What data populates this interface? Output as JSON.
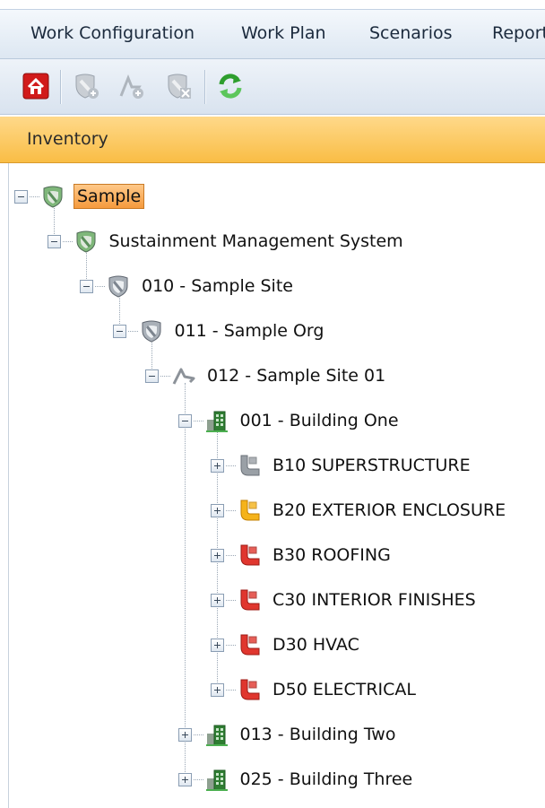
{
  "menu": {
    "items": [
      {
        "name": "menu-work-configuration",
        "label": "Work Configuration"
      },
      {
        "name": "menu-work-plan",
        "label": "Work Plan"
      },
      {
        "name": "menu-scenarios",
        "label": "Scenarios"
      },
      {
        "name": "menu-reports",
        "label": "Report"
      }
    ]
  },
  "toolbar": {
    "buttons": [
      {
        "name": "home-icon",
        "enabled": true
      },
      {
        "name": "add-shield-icon",
        "enabled": false
      },
      {
        "name": "add-site-icon",
        "enabled": false
      },
      {
        "name": "delete-shield-icon",
        "enabled": false
      },
      {
        "name": "refresh-icon",
        "enabled": true
      }
    ]
  },
  "panel": {
    "title": "Inventory"
  },
  "tree": {
    "nodes": [
      {
        "label": "Sample",
        "icon": "shield-icon",
        "level": 0,
        "expanded": true,
        "selected": true
      },
      {
        "label": "Sustainment Management System",
        "icon": "shield-icon",
        "level": 1,
        "expanded": true
      },
      {
        "label": "010 - Sample Site",
        "icon": "shield-gray-icon",
        "level": 2,
        "expanded": true
      },
      {
        "label": "011 - Sample Org",
        "icon": "shield-gray-icon",
        "level": 3,
        "expanded": true
      },
      {
        "label": "012 - Sample Site 01",
        "icon": "site-flag-icon",
        "level": 4,
        "expanded": true
      },
      {
        "label": "001 - Building One",
        "icon": "building-icon",
        "level": 5,
        "expanded": true
      },
      {
        "label": "B10 SUPERSTRUCTURE",
        "icon": "pipe-gray-icon",
        "level": 6,
        "expanded": false
      },
      {
        "label": "B20 EXTERIOR ENCLOSURE",
        "icon": "pipe-yellow-icon",
        "level": 6,
        "expanded": false
      },
      {
        "label": "B30 ROOFING",
        "icon": "pipe-red-icon",
        "level": 6,
        "expanded": false
      },
      {
        "label": "C30 INTERIOR FINISHES",
        "icon": "pipe-red-icon",
        "level": 6,
        "expanded": false
      },
      {
        "label": "D30 HVAC",
        "icon": "pipe-red-icon",
        "level": 6,
        "expanded": false
      },
      {
        "label": "D50 ELECTRICAL",
        "icon": "pipe-red-icon",
        "level": 6,
        "expanded": false
      },
      {
        "label": "013 - Building Two",
        "icon": "building-icon",
        "level": 5,
        "expanded": false
      },
      {
        "label": "025 - Building Three",
        "icon": "building-icon",
        "level": 5,
        "expanded": false
      }
    ]
  }
}
